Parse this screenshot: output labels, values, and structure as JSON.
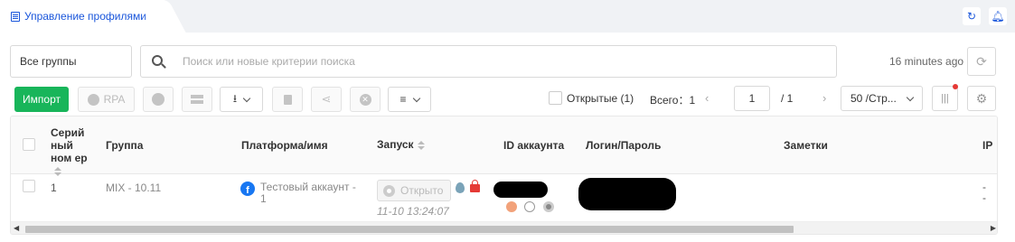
{
  "tab": {
    "label": "Управление профилями"
  },
  "filters": {
    "group_select": "Все группы",
    "search_placeholder": "Поиск или новые критерии поиска",
    "updated": "16 minutes ago"
  },
  "toolbar": {
    "import_label": "Импорт",
    "rpa_label": "RPA"
  },
  "pager": {
    "open_label": "Открытые (1)",
    "total_label": "Всего：1",
    "page": "1",
    "pages": "/ 1",
    "per_page": "50 /Стр..."
  },
  "table": {
    "headers": {
      "serial": "Серий ный ном ер",
      "group": "Группа",
      "platform": "Платформа/имя",
      "launch": "Запуск",
      "account_id": "ID аккаунта",
      "login": "Логин/Пароль",
      "notes": "Заметки",
      "ip": "IP"
    },
    "rows": [
      {
        "serial": "1",
        "group": "MIX - 10.11",
        "platform_name": "Тестовый аккаунт - 1",
        "open_label": "Открыто",
        "launch_time": "11-10 13:24:07",
        "ip": "- -"
      }
    ]
  },
  "colors": {
    "accent": "#1a56db",
    "primary_button": "#18b55a",
    "alert": "#e53935",
    "facebook": "#1877f2"
  }
}
